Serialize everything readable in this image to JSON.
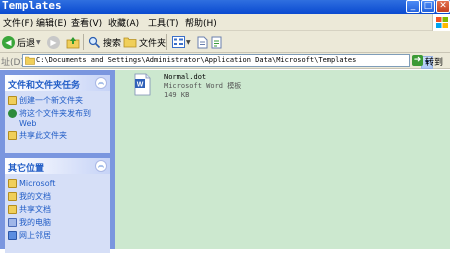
{
  "window": {
    "title": "Templates"
  },
  "menu": [
    "文件(F)",
    "编辑(E)",
    "查看(V)",
    "收藏(A)",
    "工具(T)",
    "帮助(H)"
  ],
  "toolbar": {
    "back_label": "后退",
    "search_label": "搜索",
    "folders_label": "文件夹"
  },
  "address": {
    "label": "址(D)",
    "path": "C:\\Documents and Settings\\Administrator\\Application Data\\Microsoft\\Templates",
    "go_label": "转到"
  },
  "tasks_panel": {
    "title": "文件和文件夹任务",
    "items": [
      "创建一个新文件夹",
      "将这个文件夹发布到",
      "Web",
      "共享此文件夹"
    ]
  },
  "places_panel": {
    "title": "其它位置",
    "items": [
      "Microsoft",
      "我的文档",
      "共享文档",
      "我的电脑",
      "网上邻居"
    ]
  },
  "file": {
    "name": "Normal.dot",
    "type": "Microsoft Word 模板",
    "size": "149 KB"
  },
  "colors": {
    "titlebar": "#0a4ad0",
    "content_bg": "#cce8cf",
    "taskpane": "#7a96df",
    "link": "#215dc6"
  }
}
